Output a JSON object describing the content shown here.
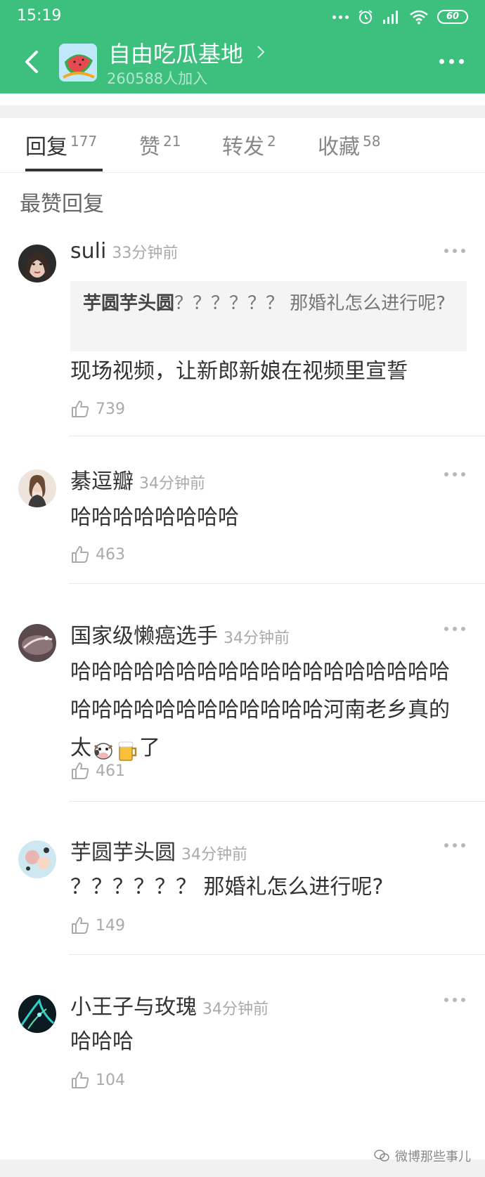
{
  "status_bar": {
    "time": "15:19",
    "battery": "60"
  },
  "header": {
    "group_name": "自由吃瓜基地",
    "members": "260588人加入",
    "back_icon": "chevron-left-icon",
    "more_icon": "more-icon",
    "accent_color": "#3dbf7e"
  },
  "tabs": [
    {
      "label": "回复",
      "count": "177"
    },
    {
      "label": "赞",
      "count": "21"
    },
    {
      "label": "转发",
      "count": "2"
    },
    {
      "label": "收藏",
      "count": "58"
    }
  ],
  "section_title": "最赞回复",
  "comments": [
    {
      "name": "suli",
      "time": "33分钟前",
      "quote_author": "芋圆芋头圆",
      "quote_text": "？？？？？？ 那婚礼怎么进行呢?",
      "text": "现场视频，让新郎新娘在视频里宣誓",
      "likes": "739"
    },
    {
      "name": "綦逗瓣",
      "time": "34分钟前",
      "text": "哈哈哈哈哈哈哈哈",
      "likes": "463"
    },
    {
      "name": "国家级懒癌选手",
      "time": "34分钟前",
      "text": "哈哈哈哈哈哈哈哈哈哈哈哈哈哈哈哈哈哈哈哈哈哈哈哈哈哈哈哈哈哈河南老乡真的太",
      "text_end": "了",
      "likes": "461"
    },
    {
      "name": "芋圆芋头圆",
      "time": "34分钟前",
      "text": "？？？？？？ 那婚礼怎么进行呢?",
      "likes": "149"
    },
    {
      "name": "小王子与玫瑰",
      "time": "34分钟前",
      "text": "哈哈哈",
      "likes": "104"
    }
  ],
  "watermark": "微博那些事儿"
}
